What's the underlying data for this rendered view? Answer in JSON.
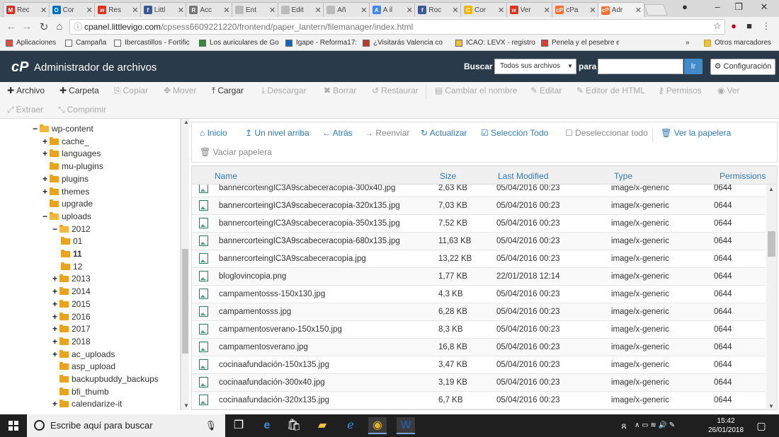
{
  "browser": {
    "tabs": [
      {
        "icon": "M",
        "icon_color": "#d93025",
        "label": "Rec"
      },
      {
        "icon": "O",
        "icon_color": "#0072c6",
        "label": "Cor"
      },
      {
        "icon": "w",
        "icon_color": "#e0301e",
        "label": "Res"
      },
      {
        "icon": "f",
        "icon_color": "#3b5998",
        "label": "Littl"
      },
      {
        "icon": "R",
        "icon_color": "#777777",
        "label": "Acc"
      },
      {
        "icon": "",
        "icon_color": "#bbbbbb",
        "label": "Ent"
      },
      {
        "icon": "",
        "icon_color": "#bbbbbb",
        "label": "Edit"
      },
      {
        "icon": "",
        "icon_color": "#bbbbbb",
        "label": "Añ"
      },
      {
        "icon": "A",
        "icon_color": "#4285f4",
        "label": "A il"
      },
      {
        "icon": "f",
        "icon_color": "#3b5998",
        "label": "Roc"
      },
      {
        "icon": "C",
        "icon_color": "#f4b400",
        "label": "Cor"
      },
      {
        "icon": "w",
        "icon_color": "#e0301e",
        "label": "Ver"
      },
      {
        "icon": "cP",
        "icon_color": "#ff6c2c",
        "label": "cPa"
      },
      {
        "icon": "cP",
        "icon_color": "#ff6c2c",
        "label": "Adr"
      }
    ],
    "url_host": "cpanel.littlevigo.com",
    "url_path": "/cpsess6609221220/frontend/paper_lantern/filemanager/index.html",
    "bookmarks": [
      "Aplicaciones",
      "Campaña",
      "Ibercastillos - Fortific",
      "Los auriculares de Go",
      "Igape - Reforma17: P",
      "¿Visitarás Valencia co",
      "ICAO: LEVX - registro",
      "Penela y el pesebre e"
    ],
    "other_bookmarks": "Otros marcadores",
    "bookmarks_more": "»"
  },
  "header": {
    "logo": "cP",
    "title": "Administrador de archivos",
    "search_label": "Buscar",
    "scope_selected": "Todos sus archivos",
    "for_label": "para",
    "search_value": "",
    "go_label": "Ir",
    "config_label": "Configuración"
  },
  "toolbar": {
    "archivo": "Archivo",
    "carpeta": "Carpeta",
    "copiar": "Copiar",
    "mover": "Mover",
    "cargar": "Cargar",
    "descargar": "Descargar",
    "borrar": "Borrar",
    "restaurar": "Restaurar",
    "cambiar_nombre": "Cambiar el nombre",
    "editar": "Editar",
    "editor_html": "Editor de HTML",
    "permisos": "Permisos",
    "ver": "Ver",
    "extraer": "Extraer",
    "comprimir": "Comprimir"
  },
  "tree": [
    {
      "label": "wp-content",
      "pm": "−",
      "open": true
    },
    {
      "label": "cache_",
      "pm": "+",
      "open": false
    },
    {
      "label": "languages",
      "pm": "+",
      "open": false
    },
    {
      "label": "mu-plugins",
      "pm": "",
      "open": false
    },
    {
      "label": "plugins",
      "pm": "+",
      "open": false
    },
    {
      "label": "themes",
      "pm": "+",
      "open": false
    },
    {
      "label": "upgrade",
      "pm": "",
      "open": false
    },
    {
      "label": "uploads",
      "pm": "−",
      "open": true
    },
    {
      "label": "2012",
      "pm": "−",
      "open": true
    },
    {
      "label": "01",
      "pm": "",
      "open": false
    },
    {
      "label": "11",
      "pm": "",
      "open": false,
      "bold": true
    },
    {
      "label": "12",
      "pm": "",
      "open": false
    },
    {
      "label": "2013",
      "pm": "+",
      "open": false
    },
    {
      "label": "2014",
      "pm": "+",
      "open": false
    },
    {
      "label": "2015",
      "pm": "+",
      "open": false
    },
    {
      "label": "2016",
      "pm": "+",
      "open": false
    },
    {
      "label": "2017",
      "pm": "+",
      "open": false
    },
    {
      "label": "2018",
      "pm": "+",
      "open": false
    },
    {
      "label": "ac_uploads",
      "pm": "+",
      "open": false
    },
    {
      "label": "asp_upload",
      "pm": "",
      "open": false
    },
    {
      "label": "backupbuddy_backups",
      "pm": "",
      "open": false
    },
    {
      "label": "bfi_thumb",
      "pm": "",
      "open": false
    },
    {
      "label": "calendarize-it",
      "pm": "+",
      "open": false
    }
  ],
  "nav": {
    "inicio": "Inicio",
    "up": "Un nivel arriba",
    "atras": "Atrás",
    "reenviar": "Reenviar",
    "actualizar": "Actualizar",
    "sel_todo": "Selección Todo",
    "desel": "Deseleccionar todo",
    "papelera": "Ver la papelera",
    "vaciar": "Vaciar papelera"
  },
  "columns": {
    "name": "Name",
    "size": "Size",
    "modified": "Last Modified",
    "type": "Type",
    "perms": "Permissions"
  },
  "files": [
    {
      "name": "bannercorteingIC3A9scabeceracopia-300x40.jpg",
      "size": "2,63 KB",
      "modified": "05/04/2016 00:23",
      "type": "image/x-generic",
      "perms": "0644"
    },
    {
      "name": "bannercorteingIC3A9scabeceracopia-320x135.jpg",
      "size": "7,03 KB",
      "modified": "05/04/2016 00:23",
      "type": "image/x-generic",
      "perms": "0644"
    },
    {
      "name": "bannercorteingIC3A9scabeceracopia-350x135.jpg",
      "size": "7,52 KB",
      "modified": "05/04/2016 00:23",
      "type": "image/x-generic",
      "perms": "0644"
    },
    {
      "name": "bannercorteingIC3A9scabeceracopia-680x135.jpg",
      "size": "11,63 KB",
      "modified": "05/04/2016 00:23",
      "type": "image/x-generic",
      "perms": "0644"
    },
    {
      "name": "bannercorteingIC3A9scabeceracopia.jpg",
      "size": "13,22 KB",
      "modified": "05/04/2016 00:23",
      "type": "image/x-generic",
      "perms": "0644"
    },
    {
      "name": "bloglovincopia.png",
      "size": "1,77 KB",
      "modified": "22/01/2018 12:14",
      "type": "image/x-generic",
      "perms": "0644"
    },
    {
      "name": "campamentosss-150x130.jpg",
      "size": "4,3 KB",
      "modified": "05/04/2016 00:23",
      "type": "image/x-generic",
      "perms": "0644"
    },
    {
      "name": "campamentosss.jpg",
      "size": "6,28 KB",
      "modified": "05/04/2016 00:23",
      "type": "image/x-generic",
      "perms": "0644"
    },
    {
      "name": "campamentosverano-150x150.jpg",
      "size": "8,3 KB",
      "modified": "05/04/2016 00:23",
      "type": "image/x-generic",
      "perms": "0644"
    },
    {
      "name": "campamentosverano.jpg",
      "size": "16,8 KB",
      "modified": "05/04/2016 00:23",
      "type": "image/x-generic",
      "perms": "0644"
    },
    {
      "name": "cocinaafundación-150x135.jpg",
      "size": "3,47 KB",
      "modified": "05/04/2016 00:23",
      "type": "image/x-generic",
      "perms": "0644"
    },
    {
      "name": "cocinaafundación-300x40.jpg",
      "size": "3,19 KB",
      "modified": "05/04/2016 00:23",
      "type": "image/x-generic",
      "perms": "0644"
    },
    {
      "name": "cocinaafundación-320x135.jpg",
      "size": "6,7 KB",
      "modified": "05/04/2016 00:23",
      "type": "image/x-generic",
      "perms": "0644"
    }
  ],
  "taskbar": {
    "search_placeholder": "Escribe aquí para buscar",
    "time": "15:42",
    "date": "26/01/2018"
  }
}
